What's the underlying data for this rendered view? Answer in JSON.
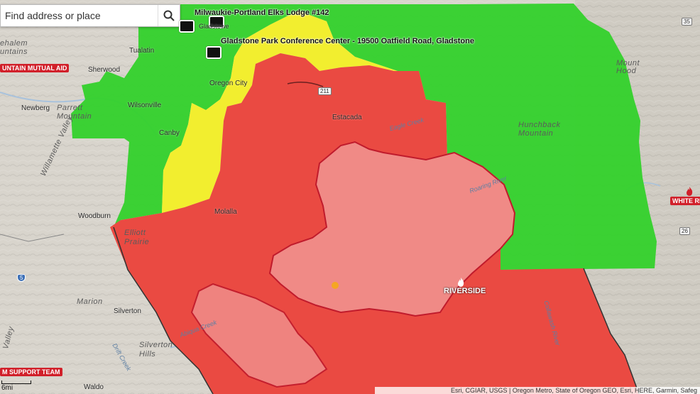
{
  "search": {
    "placeholder": "Find address or place"
  },
  "pois": [
    {
      "name": "Milwaukie-Portland Elks Lodge #142"
    },
    {
      "name": "Gladstone Park Conference Center - 19500 Oatfield Road, Gladstone"
    }
  ],
  "fires": [
    {
      "name": "RIVERSIDE"
    },
    {
      "name": "WHITE RIV"
    }
  ],
  "tags": [
    "UNTAIN MUTUAL AID",
    "M SUPPORT TEAM"
  ],
  "places": {
    "tualatin": "Tualatin",
    "sherwood": "Sherwood",
    "oregon_city": "Oregon City",
    "newberg": "Newberg",
    "wilsonville": "Wilsonville",
    "canby": "Canby",
    "estacada": "Estacada",
    "molalla": "Molalla",
    "woodburn": "Woodburn",
    "silverton": "Silverton",
    "waldo": "Waldo",
    "gladstone_partial": "Gladstowe",
    "mount_hood": "Mount\nHood",
    "marion": "Marion"
  },
  "regions": {
    "chehalem": "ehalem\nuntains",
    "parrett": "Parrett\nMountain",
    "willamette_valley": "Willamette Valley",
    "elliott_prairie": "Elliott\nPrairie",
    "silverton_hills": "Silverton\nHills",
    "hunchback": "Hunchback\nMountain",
    "valley_left": "Valley"
  },
  "water": {
    "eagle_creek": "Eagle Creek",
    "abiqua_creek": "Abiqua Creek",
    "drift_creek": "Drift Creek",
    "roaring_river": "Roaring River",
    "collawash_river": "Collawash River"
  },
  "highways": {
    "h211": "211",
    "h35": "35",
    "h26": "26",
    "h5": "5"
  },
  "scale": {
    "label": "6mi"
  },
  "attribution": "Esri, CGIAR, USGS | Oregon Metro, State of Oregon GEO, Esri, HERE, Garmin, Safeg",
  "colors": {
    "green_zone": "#33d12b",
    "yellow_zone": "#f2ee2f",
    "red_zone": "#ea4a42",
    "fire_perimeter": "#c01b2c"
  }
}
